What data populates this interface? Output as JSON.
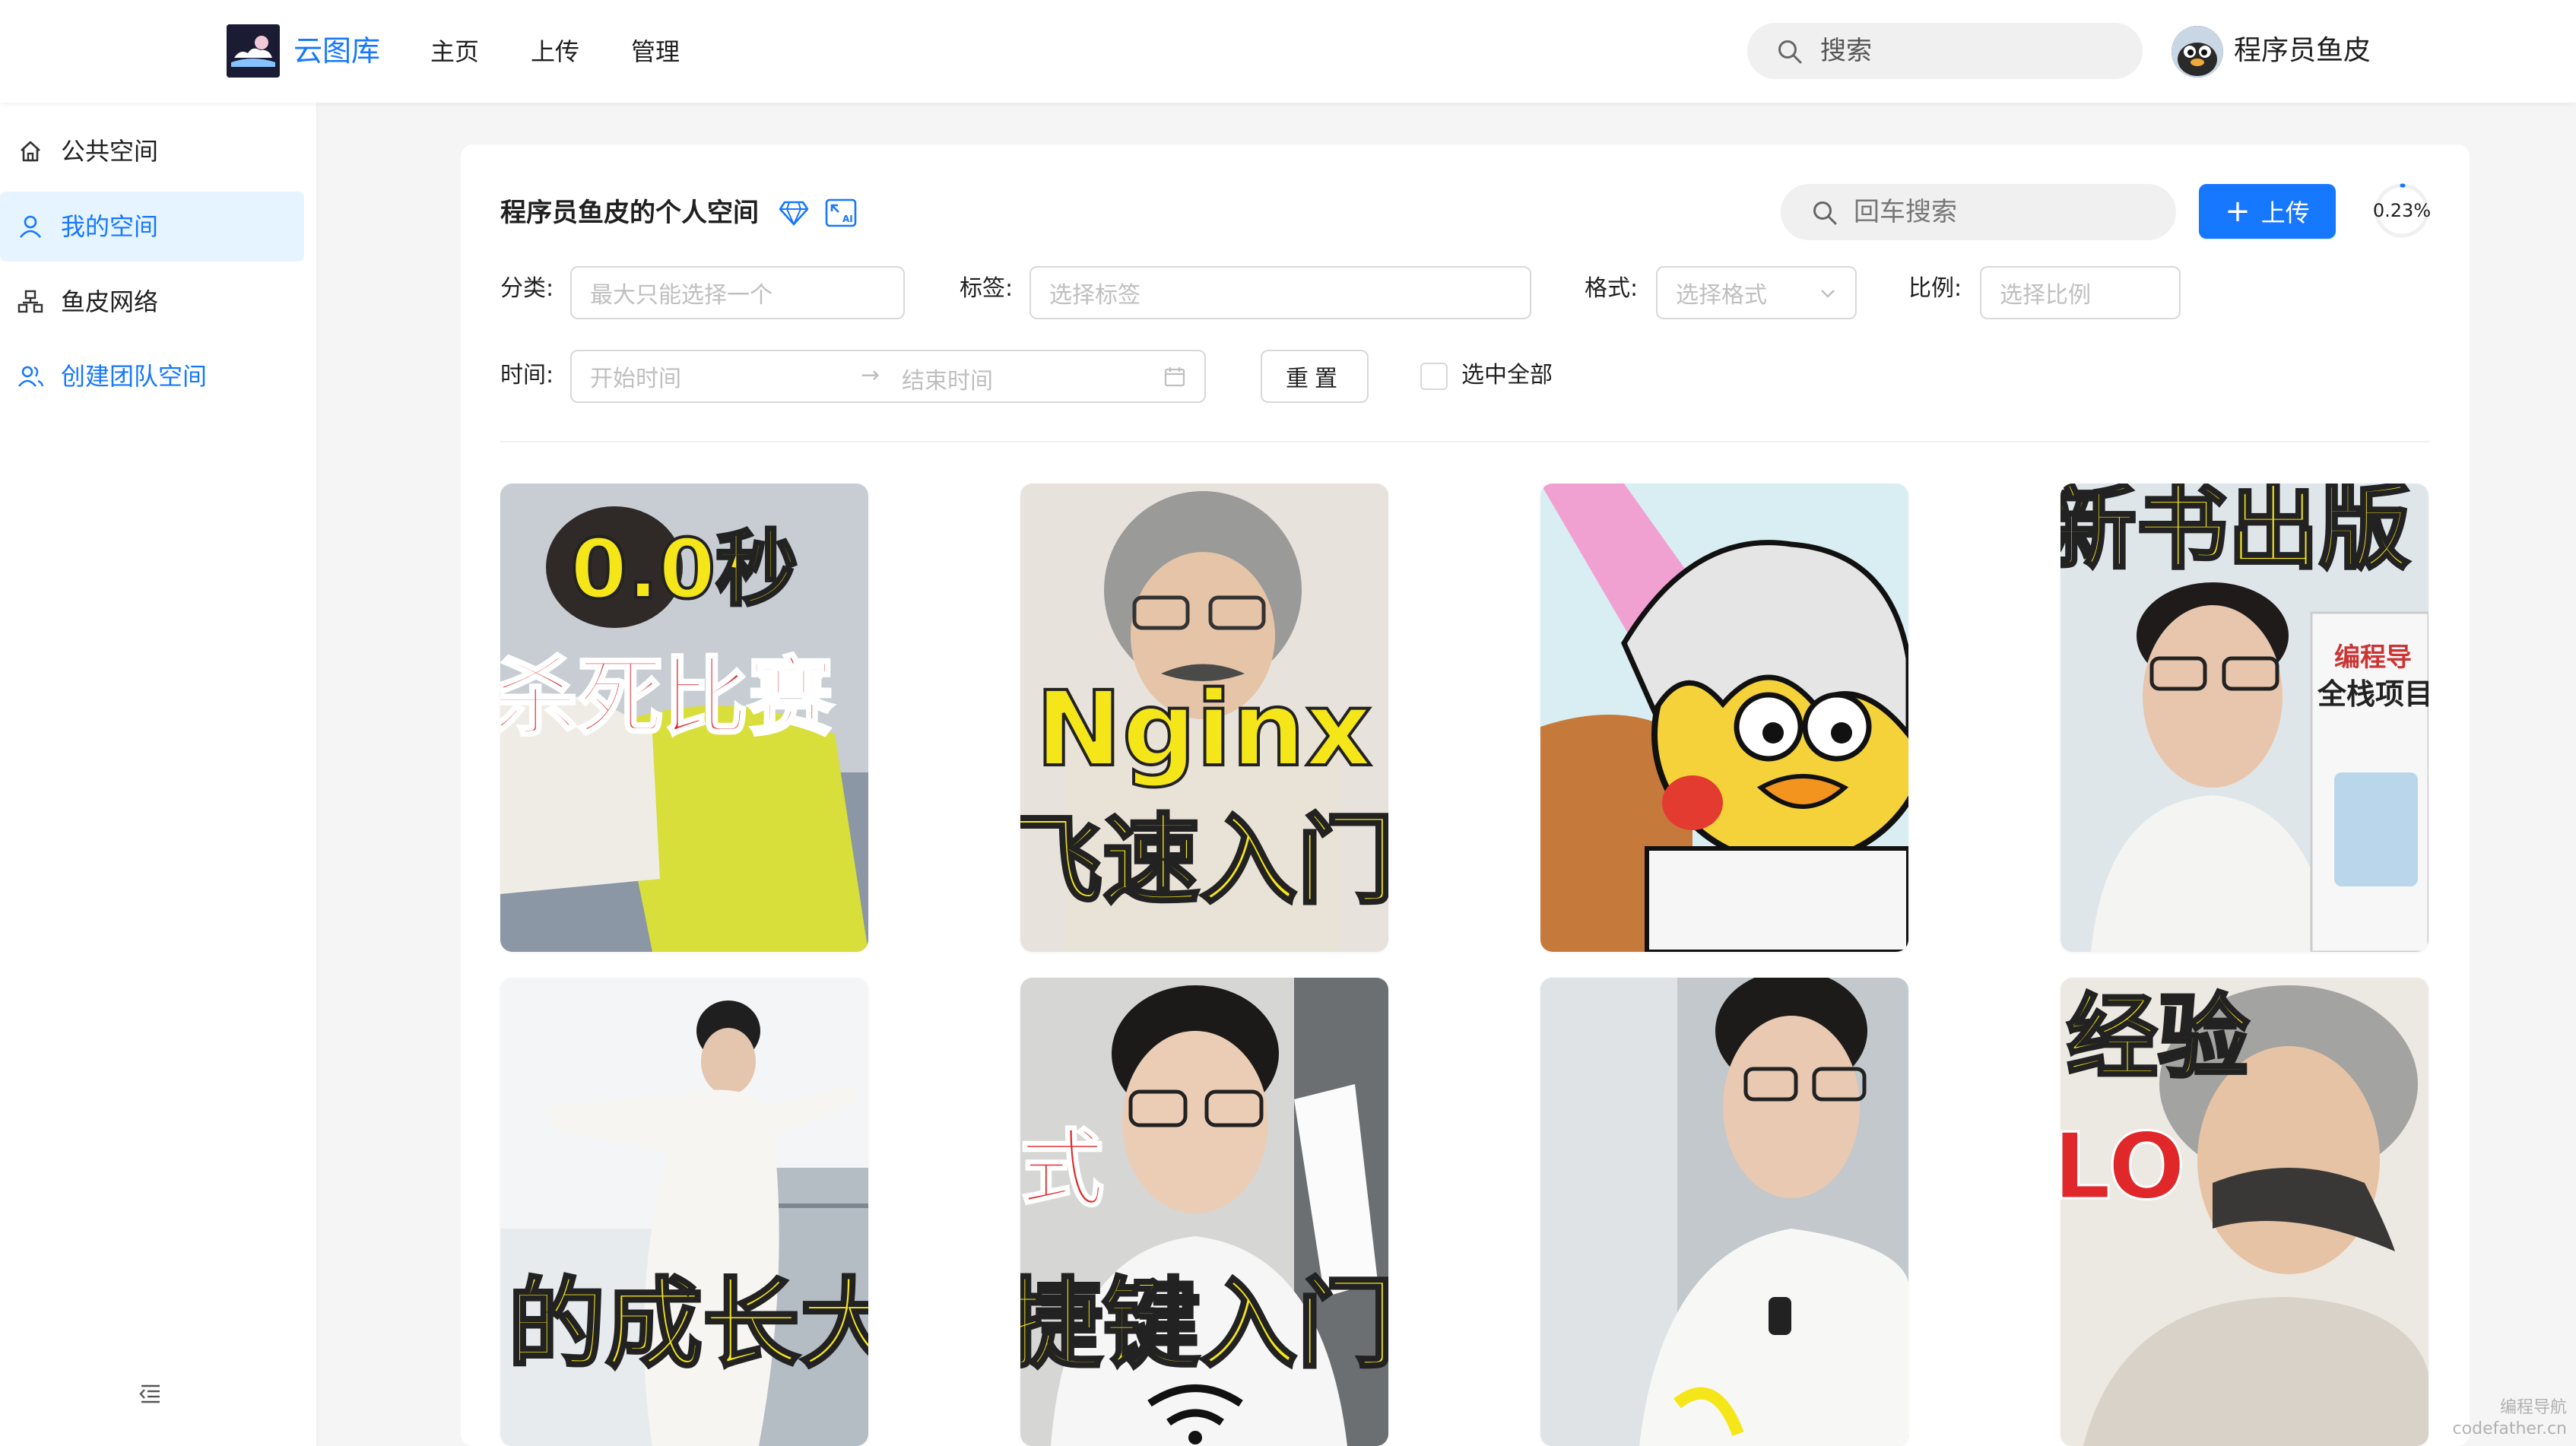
{
  "header": {
    "logo_text": "云图库",
    "nav": [
      "主页",
      "上传",
      "管理"
    ],
    "search_placeholder": "搜索",
    "user_name": "程序员鱼皮"
  },
  "sidebar": {
    "items": [
      {
        "label": "公共空间",
        "icon": "home-icon"
      },
      {
        "label": "我的空间",
        "icon": "user-icon"
      },
      {
        "label": "鱼皮网络",
        "icon": "team-icon"
      },
      {
        "label": "创建团队空间",
        "icon": "team-add-icon"
      }
    ],
    "active_index": 1
  },
  "space": {
    "title": "程序员鱼皮的个人空间",
    "search_placeholder": "回车搜索",
    "upload_label": "上传",
    "usage_percent": "0.23%",
    "usage_value": 0.0023
  },
  "filters": {
    "category_label": "分类",
    "category_placeholder": "最大只能选择一个",
    "tag_label": "标签",
    "tag_placeholder": "选择标签",
    "format_label": "格式",
    "format_placeholder": "选择格式",
    "ratio_label": "比例",
    "ratio_placeholder": "选择比例",
    "time_label": "时间",
    "time_start_placeholder": "开始时间",
    "time_end_placeholder": "结束时间",
    "reset_label": "重置",
    "select_all_label": "选中全部"
  },
  "pictures": [
    {
      "caption_lines": [
        "0.0秒",
        "杀死比赛"
      ]
    },
    {
      "caption_lines": [
        "Nginx",
        "飞速入门"
      ]
    },
    {
      "caption_lines": []
    },
    {
      "caption_lines": [
        "新书出版"
      ]
    },
    {
      "caption_lines": [
        "的成长大"
      ]
    },
    {
      "caption_lines": [
        "式",
        "捷键入门"
      ]
    },
    {
      "caption_lines": []
    },
    {
      "caption_lines": [
        "经验",
        "LO"
      ]
    }
  ],
  "watermark": [
    "编程导航",
    "codefather.cn"
  ],
  "colors": {
    "primary": "#1677ff",
    "active_bg": "#e6f4ff",
    "caption_yellow": "#f5e61a",
    "caption_red": "#e0282a"
  }
}
